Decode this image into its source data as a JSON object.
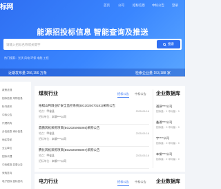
{
  "header": {
    "brand": "标网",
    "nav": [
      "首页",
      "公司",
      "招标信息",
      "中标公告",
      "登录"
    ]
  },
  "hero": {
    "headline": "能源招投标信息 智能查询及推送",
    "search_placeholder": "请输入招标名称或关键字",
    "search_button": "搜索",
    "hot_searches": "热门搜索：光伏 风电 环保 电能 工程",
    "stat_left_prefix": "近期发布量 ",
    "stat_left_value": "256,156",
    "stat_left_suffix": " 万条",
    "stat_right_prefix": "检索企业量 ",
    "stat_right_value": "153,188",
    "stat_right_suffix": " 家"
  },
  "sidebar": {
    "items": [
      "政策法规",
      "招标信息  采购信息",
      "标书资讯",
      "中标公告",
      "代理机构",
      "分包信息  询价信息",
      "地区导航",
      "业主单位",
      "招标代理",
      "中标候选  变更公告",
      "采购意向",
      "电子招标  投标资讯"
    ]
  },
  "section1": {
    "title": "煤炭行业",
    "tab_active": "招标公告",
    "tab_other": "中标公告",
    "items": [
      {
        "title": "柏棋山鸭煤业矿安全监控系统(BG2025070181)采购公告",
        "region_label": "地点：",
        "region": "甲省县",
        "date": "2025-06-16",
        "unit_label": "招标单位：",
        "unit": "本钢****公司"
      },
      {
        "title": "鼎鹏风机采购项目(BG2025065065)采购公告",
        "region_label": "地点：",
        "region": "甲省县",
        "date": "2025-06-16",
        "unit_label": "招标单位：",
        "unit": "本钢****公司"
      },
      {
        "title": "腾长风机采购项目(BG2025065067)采购公告",
        "region_label": "地点：",
        "region": "甲省县",
        "date": "2025-06-16",
        "unit_label": "招标单位：",
        "unit": "本钢****公司"
      }
    ]
  },
  "companies1": {
    "title": "企业数据库",
    "rows": [
      {
        "name": "通源****公司",
        "sub": "招标量：1   中标量：0"
      },
      {
        "name": "鑫通****公司",
        "sub": "招标量：0   中标量：0"
      },
      {
        "name": "宇****公司",
        "sub": "招标量：0   中标量：0"
      },
      {
        "name": "本钢****公司",
        "sub": "招标量：2   中标量：0"
      }
    ]
  },
  "section2": {
    "title": "电力行业",
    "tab_active": "招标公告",
    "tab_other": "中标公告",
    "company_title": "企业数据库"
  }
}
